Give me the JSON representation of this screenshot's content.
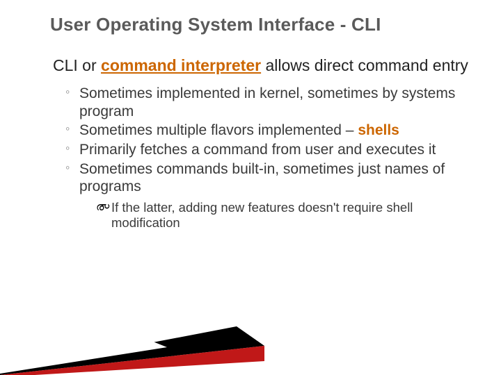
{
  "title": "User Operating System Interface - CLI",
  "lead": {
    "pre": "CLI or ",
    "strong": "command interpreter",
    "post": " allows direct command entry"
  },
  "bullets": [
    {
      "text_a": "Sometimes implemented in kernel, sometimes by systems program"
    },
    {
      "text_a": "Sometimes multiple flavors implemented – ",
      "strong": "shells"
    },
    {
      "text_a": "Primarily fetches a command from user and executes it"
    },
    {
      "text_a": "Sometimes commands built-in, sometimes just names of programs"
    }
  ],
  "subnote": {
    "icon": "൞",
    "text": "If the latter, adding new features doesn't require shell modification"
  }
}
